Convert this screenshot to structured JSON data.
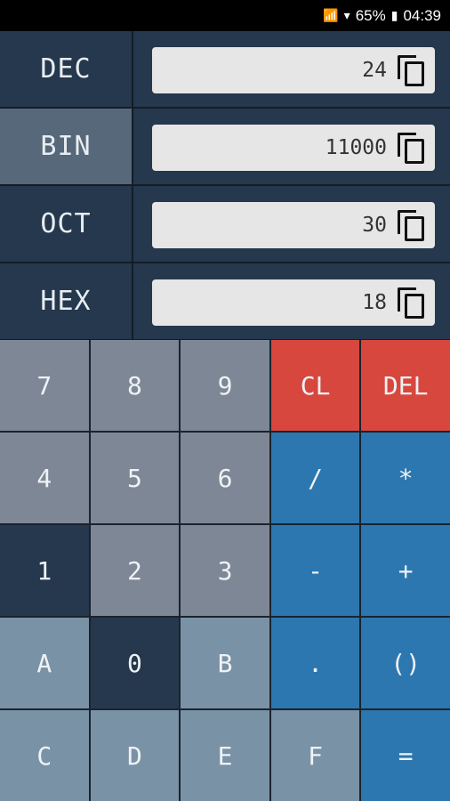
{
  "status": {
    "battery": "65%",
    "time": "04:39"
  },
  "rows": [
    {
      "label": "DEC",
      "value": "24"
    },
    {
      "label": "BIN",
      "value": "11000"
    },
    {
      "label": "OCT",
      "value": "30"
    },
    {
      "label": "HEX",
      "value": "18"
    }
  ],
  "keys": {
    "k7": "7",
    "k8": "8",
    "k9": "9",
    "cl": "CL",
    "del": "DEL",
    "k4": "4",
    "k5": "5",
    "k6": "6",
    "div": "/",
    "mul": "*",
    "k1": "1",
    "k2": "2",
    "k3": "3",
    "minus": "-",
    "plus": "+",
    "ka": "A",
    "k0": "0",
    "kb": "B",
    "dot": ".",
    "paren": "()",
    "kc": "C",
    "kd": "D",
    "ke": "E",
    "kf": "F",
    "eq": "="
  },
  "colors": {
    "row_bg": "#25384d",
    "row_selected_bg": "#56687a",
    "number_key": "#7d8796",
    "hex_key": "#7a92a6",
    "clear_key": "#d7473d",
    "operator_key": "#2c77b0"
  },
  "selected_base": "BIN"
}
